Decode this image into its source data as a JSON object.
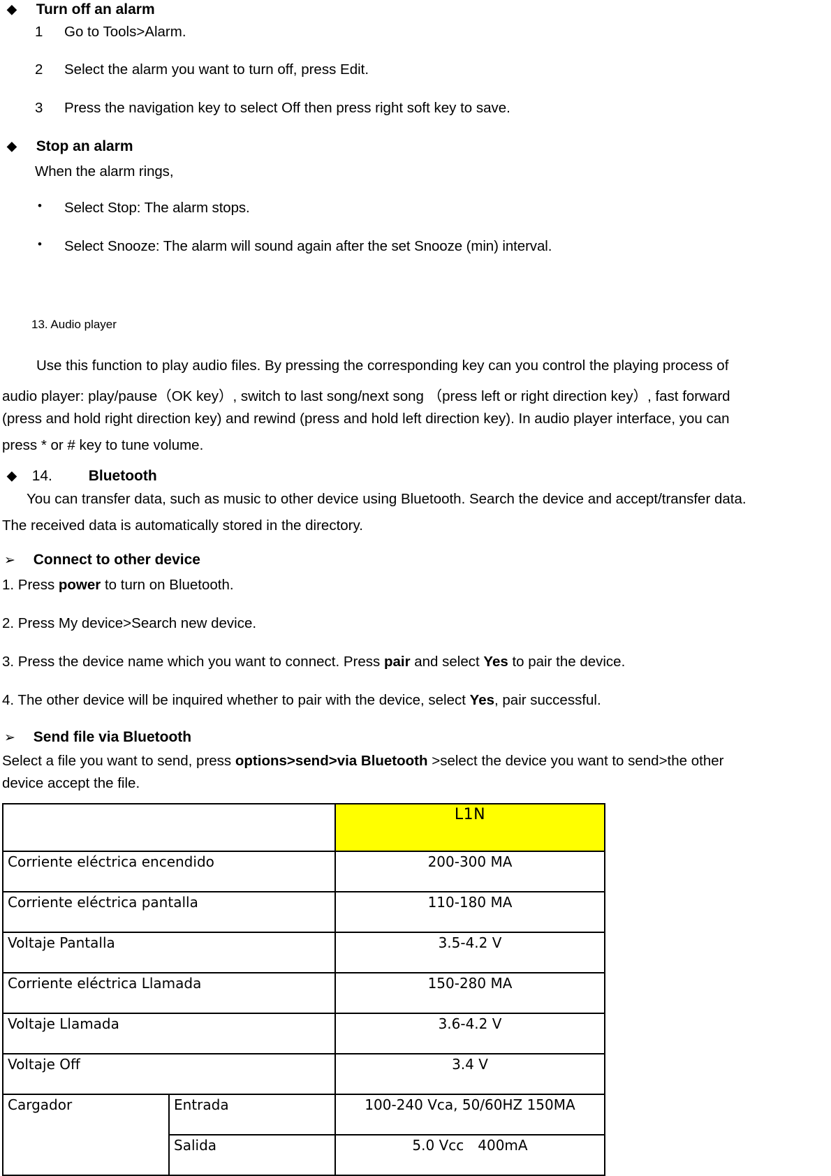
{
  "document": {
    "sections": [
      {
        "id": "turn-off-alarm",
        "bullet": "◆",
        "heading": "Turn off an alarm",
        "steps": [
          {
            "num": "1",
            "text": "Go to Tools>Alarm."
          },
          {
            "num": "2",
            "text": "Select the alarm you want to turn off, press Edit."
          },
          {
            "num": "3",
            "text": "Press the navigation key to select Off then press right soft key to save."
          }
        ]
      },
      {
        "id": "stop-alarm",
        "bullet": "◆",
        "heading": "Stop an alarm",
        "intro": "When the alarm rings,",
        "bullet_glyph": "•",
        "items": [
          "Select Stop: The alarm stops.",
          "Select Snooze: The alarm will sound again after the set Snooze (min) interval."
        ]
      }
    ],
    "audio_player": {
      "heading": "13. Audio player",
      "paragraph_lines": [
        "Use this function to play audio files. By pressing the corresponding key can you control the playing process of",
        "audio player: play/pause（OK key）, switch to last song/next song  （press left or right direction key）, fast forward",
        "(press and hold right direction key) and rewind (press and hold left direction key). In audio player interface, you can",
        "press * or # key to tune volume."
      ]
    },
    "bluetooth": {
      "bullet": "◆",
      "number": "14.",
      "heading": "Bluetooth",
      "intro_lines": [
        "You can transfer data, such as music to other device using Bluetooth. Search the device and accept/transfer data.",
        "The received data is automatically stored in the directory."
      ],
      "arrow_glyph": "➢",
      "connect": {
        "heading": "Connect to other device",
        "steps": [
          {
            "prefix": "1. Press ",
            "bold": "power",
            "suffix": " to turn on Bluetooth."
          },
          {
            "prefix": "2. Press My device>Search new device.",
            "bold": "",
            "suffix": ""
          },
          {
            "prefix": "3. Press the device name which you want to connect. Press ",
            "bold": "pair",
            "mid": " and select ",
            "bold2": "Yes",
            "suffix": " to pair the device."
          },
          {
            "prefix": "4. The other device will be inquired whether to pair with the device, select ",
            "bold": "Yes",
            "suffix": ", pair successful."
          }
        ]
      },
      "send_file": {
        "heading": "Send file via Bluetooth",
        "line1_prefix": "Select a file you want to send, press ",
        "line1_bold": "options>send>via Bluetooth",
        "line1_suffix": " >select the device you want to send>the other",
        "line2": "device accept the file."
      }
    },
    "spec_table": {
      "header": {
        "blank": "",
        "model": "L1N",
        "model_bg": "#ffff00"
      },
      "rows": [
        {
          "label": "Corriente eléctrica encendido",
          "value": "200-300 MA"
        },
        {
          "label": "Corriente eléctrica pantalla",
          "value": "110-180 MA"
        },
        {
          "label": "Voltaje Pantalla",
          "value": "3.5-4.2 V"
        },
        {
          "label": "Corriente eléctrica Llamada",
          "value": "150-280 MA"
        },
        {
          "label": "Voltaje Llamada",
          "value": "3.6-4.2 V"
        },
        {
          "label": "Voltaje Off",
          "value": "3.4 V"
        }
      ],
      "charger": {
        "label": "Cargador",
        "sub_rows": [
          {
            "sub": "Entrada",
            "value": "100-240 Vca, 50/60HZ 150MA"
          },
          {
            "sub": "Salida",
            "value": "5.0 Vcc 400mA"
          }
        ]
      }
    }
  }
}
